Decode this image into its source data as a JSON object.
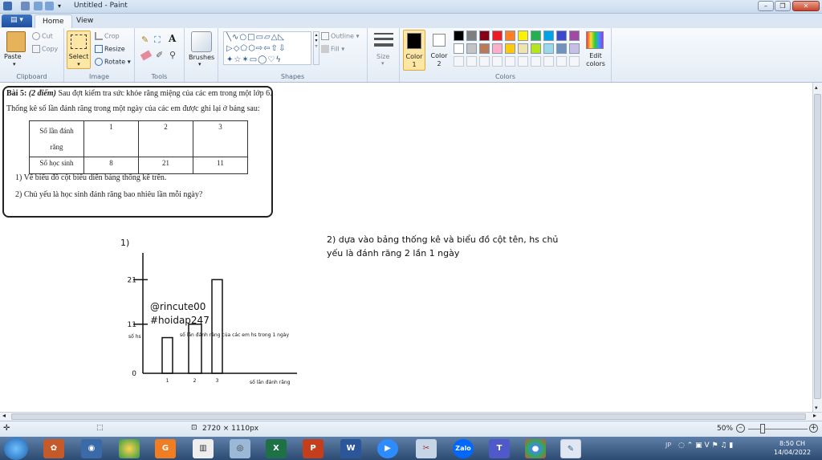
{
  "window": {
    "title": "Untitled - Paint"
  },
  "tabs": {
    "home": "Home",
    "view": "View"
  },
  "clipboard": {
    "paste": "Paste",
    "cut": "Cut",
    "copy": "Copy",
    "label": "Clipboard"
  },
  "image": {
    "select": "Select",
    "crop": "Crop",
    "resize": "Resize",
    "rotate": "Rotate",
    "label": "Image"
  },
  "tools": {
    "label": "Tools"
  },
  "brushes": {
    "label": "Brushes"
  },
  "shapes": {
    "outline": "Outline",
    "fill": "Fill",
    "label": "Shapes"
  },
  "size": {
    "label": "Size"
  },
  "colors": {
    "color1_label": "Color",
    "color1_num": "1",
    "color2_label": "Color",
    "color2_num": "2",
    "edit": "Edit",
    "edit2": "colors",
    "label": "Colors",
    "palette_row1": [
      "#000000",
      "#7f7f7f",
      "#880015",
      "#ed1c24",
      "#ff7f27",
      "#fff200",
      "#22b14c",
      "#00a2e8",
      "#3f48cc",
      "#a349a4"
    ],
    "palette_row2": [
      "#ffffff",
      "#c3c3c3",
      "#b97a57",
      "#ffaec9",
      "#ffc90e",
      "#efe4b0",
      "#b5e61d",
      "#99d9ea",
      "#7092be",
      "#c8bfe7"
    ]
  },
  "problem": {
    "line1_bold": "Bài 5:",
    "line1_italic": "(2 điểm)",
    "line1_rest": "Sau đợt kiểm tra sức khỏe răng miệng của các em trong một lớp 6.",
    "line2": "Thống kê số lần đánh răng trong một ngày của các em được ghi lại ở bảng sau:",
    "table": {
      "row1_head_a": "Số lần đánh",
      "row1_head_b": "răng",
      "row1": [
        "1",
        "2",
        "3"
      ],
      "row2_head": "Số học sinh",
      "row2": [
        "8",
        "21",
        "11"
      ]
    },
    "q1": "1)  Vẽ biểu đồ cột biểu diễn bảng thống kê trên.",
    "q2": "2)  Chủ yếu là học sinh đánh răng bao nhiêu lần  mỗi ngày?"
  },
  "answer": {
    "part1_label": "1)",
    "part2_line1": "2) dựa vào bảng thống kê và biểu đồ cột tên, hs chủ",
    "part2_line2": "yếu là đánh răng 2 lần 1 ngày",
    "watermark1": "@rincute00",
    "watermark2": "#hoidap247"
  },
  "chart_data": {
    "type": "bar",
    "title": "số lần đánh răng của các em hs trong 1 ngày",
    "ylabel": "số hs",
    "xlabel": "số lần đánh răng",
    "categories": [
      "1",
      "2",
      "3"
    ],
    "values": [
      8,
      11,
      21
    ],
    "yticks": [
      "0",
      "11",
      "21"
    ],
    "ylim": [
      0,
      27
    ]
  },
  "status": {
    "dimensions": "2720 × 1110px",
    "zoom": "50%"
  },
  "taskbar": {
    "time": "8:50 CH",
    "date": "14/04/2022",
    "lang": "JP"
  }
}
